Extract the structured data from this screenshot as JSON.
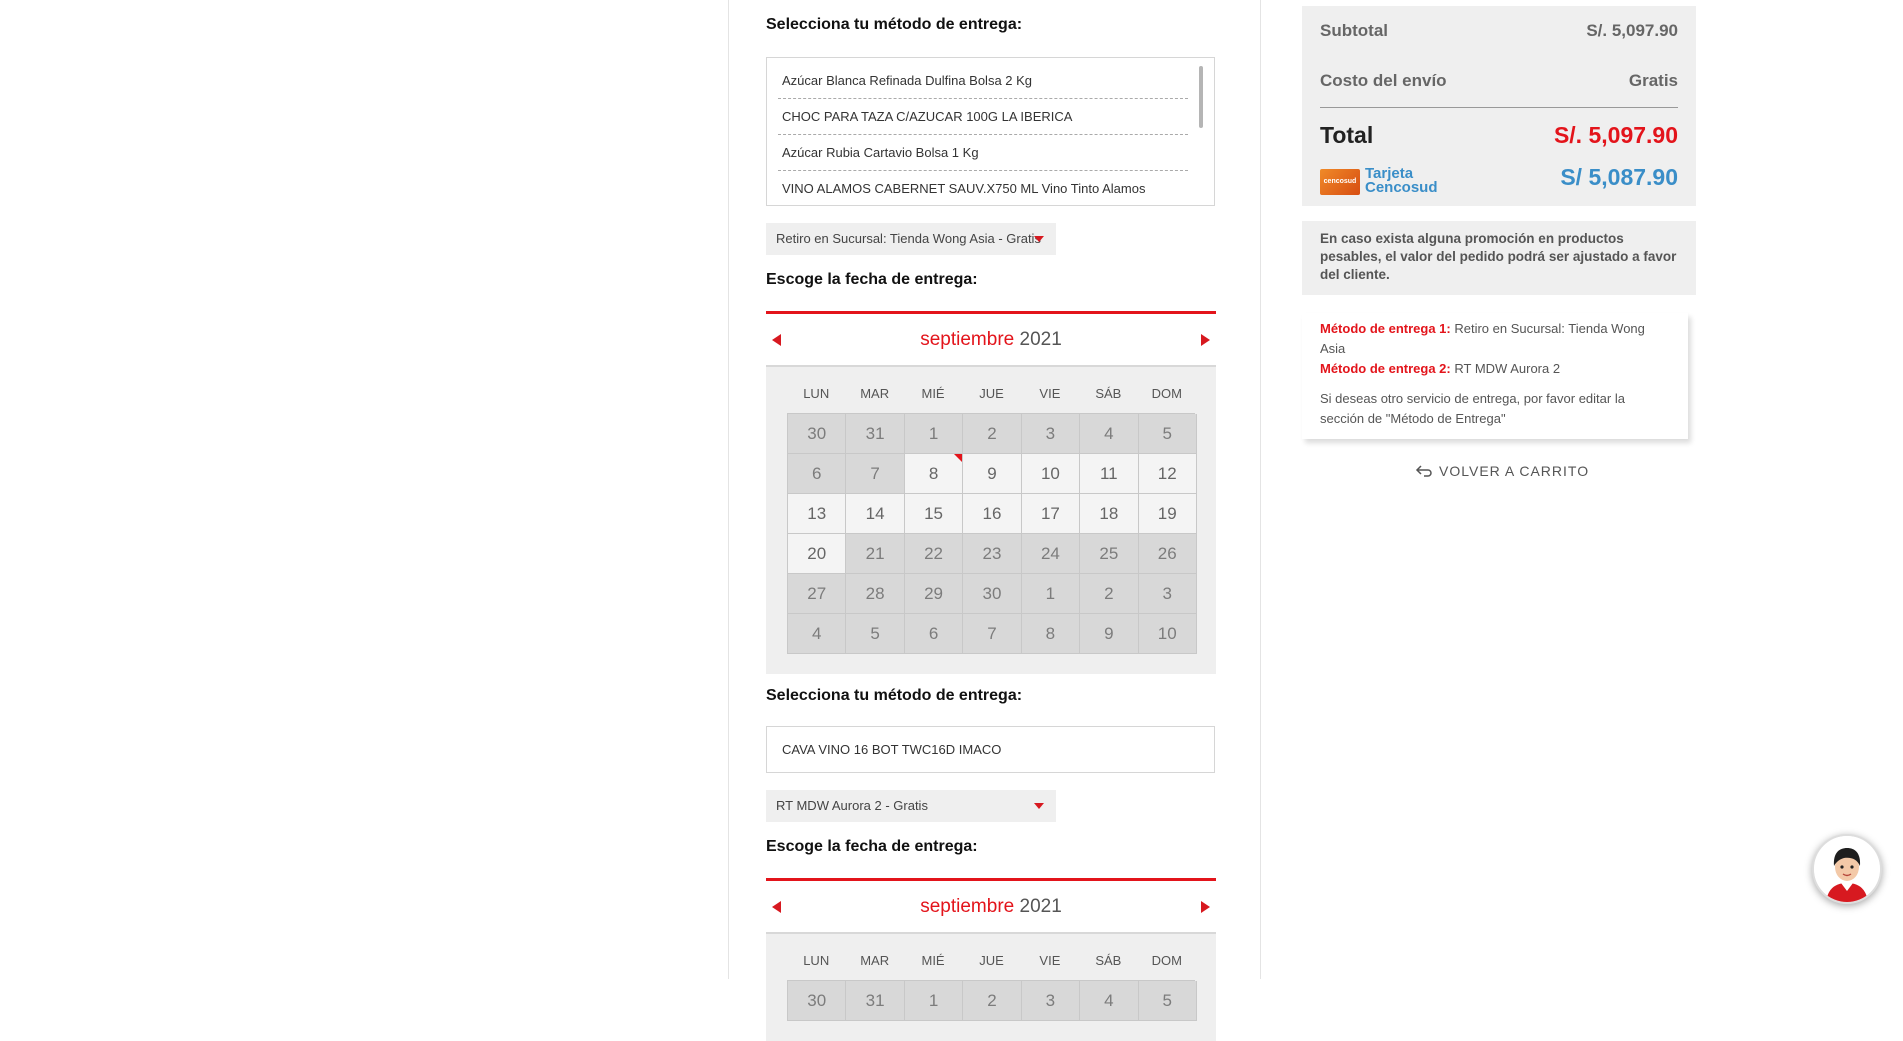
{
  "delivery_group_1": {
    "title": "Selecciona tu método de entrega:",
    "products": [
      "Azúcar Blanca Refinada Dulfina Bolsa 2 Kg",
      "CHOC PARA TAZA C/AZUCAR 100G LA IBERICA",
      "Azúcar Rubia Cartavio Bolsa 1 Kg",
      "VINO ALAMOS CABERNET SAUV.X750 ML Vino Tinto Alamos"
    ],
    "method_selected": "Retiro en Sucursal: Tienda Wong Asia - Gratis",
    "date_title": "Escoge la fecha de entrega:",
    "calendar": {
      "month": "septiembre",
      "year": "2021",
      "weekdays": [
        "LUN",
        "MAR",
        "MIÉ",
        "JUE",
        "VIE",
        "SÁB",
        "DOM"
      ],
      "days": [
        {
          "d": "30",
          "s": "dis"
        },
        {
          "d": "31",
          "s": "dis"
        },
        {
          "d": "1",
          "s": "dis"
        },
        {
          "d": "2",
          "s": "dis"
        },
        {
          "d": "3",
          "s": "dis"
        },
        {
          "d": "4",
          "s": "dis"
        },
        {
          "d": "5",
          "s": "dis"
        },
        {
          "d": "6",
          "s": "dis"
        },
        {
          "d": "7",
          "s": "dis"
        },
        {
          "d": "8",
          "s": "av",
          "today": true
        },
        {
          "d": "9",
          "s": "av"
        },
        {
          "d": "10",
          "s": "av"
        },
        {
          "d": "11",
          "s": "av"
        },
        {
          "d": "12",
          "s": "av"
        },
        {
          "d": "13",
          "s": "av"
        },
        {
          "d": "14",
          "s": "av"
        },
        {
          "d": "15",
          "s": "av"
        },
        {
          "d": "16",
          "s": "av"
        },
        {
          "d": "17",
          "s": "av"
        },
        {
          "d": "18",
          "s": "av"
        },
        {
          "d": "19",
          "s": "av"
        },
        {
          "d": "20",
          "s": "av"
        },
        {
          "d": "21",
          "s": "dis"
        },
        {
          "d": "22",
          "s": "dis"
        },
        {
          "d": "23",
          "s": "dis"
        },
        {
          "d": "24",
          "s": "dis"
        },
        {
          "d": "25",
          "s": "dis"
        },
        {
          "d": "26",
          "s": "dis"
        },
        {
          "d": "27",
          "s": "dis"
        },
        {
          "d": "28",
          "s": "dis"
        },
        {
          "d": "29",
          "s": "dis"
        },
        {
          "d": "30",
          "s": "dis"
        },
        {
          "d": "1",
          "s": "dis"
        },
        {
          "d": "2",
          "s": "dis"
        },
        {
          "d": "3",
          "s": "dis"
        },
        {
          "d": "4",
          "s": "dis"
        },
        {
          "d": "5",
          "s": "dis"
        },
        {
          "d": "6",
          "s": "dis"
        },
        {
          "d": "7",
          "s": "dis"
        },
        {
          "d": "8",
          "s": "dis"
        },
        {
          "d": "9",
          "s": "dis"
        },
        {
          "d": "10",
          "s": "dis"
        }
      ]
    }
  },
  "delivery_group_2": {
    "title": "Selecciona tu método de entrega:",
    "products": [
      "CAVA VINO 16 BOT TWC16D IMACO"
    ],
    "method_selected": "RT MDW Aurora 2 - Gratis",
    "date_title": "Escoge la fecha de entrega:",
    "calendar": {
      "month": "septiembre",
      "year": "2021",
      "weekdays": [
        "LUN",
        "MAR",
        "MIÉ",
        "JUE",
        "VIE",
        "SÁB",
        "DOM"
      ],
      "days": [
        {
          "d": "30",
          "s": "dis"
        },
        {
          "d": "31",
          "s": "dis"
        },
        {
          "d": "1",
          "s": "dis"
        },
        {
          "d": "2",
          "s": "dis"
        },
        {
          "d": "3",
          "s": "dis"
        },
        {
          "d": "4",
          "s": "dis"
        },
        {
          "d": "5",
          "s": "dis"
        }
      ]
    }
  },
  "summary": {
    "subtotal_label": "Subtotal",
    "subtotal_value": "S/. 5,097.90",
    "shipping_label": "Costo del envío",
    "shipping_value": "Gratis",
    "total_label": "Total",
    "total_value": "S/. 5,097.90",
    "card_label_line1": "Tarjeta",
    "card_label_line2": "Cencosud",
    "card_logo_text": "cencosud",
    "card_value": "S/ 5,087.90",
    "colors": {
      "total": "#e3141b",
      "card": "#3a8ec8"
    }
  },
  "notice": "En caso exista alguna promoción en productos pesables, el valor del pedido podrá ser ajustado a favor del cliente.",
  "methods_summary": {
    "m1_label": "Método de entrega 1:",
    "m1_value": " Retiro en Sucursal: Tienda Wong Asia",
    "m2_label": "Método de entrega 2:",
    "m2_value": " RT MDW Aurora 2",
    "note": "Si deseas otro servicio de entrega, por favor editar la sección de \"Método de Entrega\""
  },
  "back_link": "VOLVER A CARRITO",
  "chat": {
    "icon": "assistant-avatar-icon"
  }
}
